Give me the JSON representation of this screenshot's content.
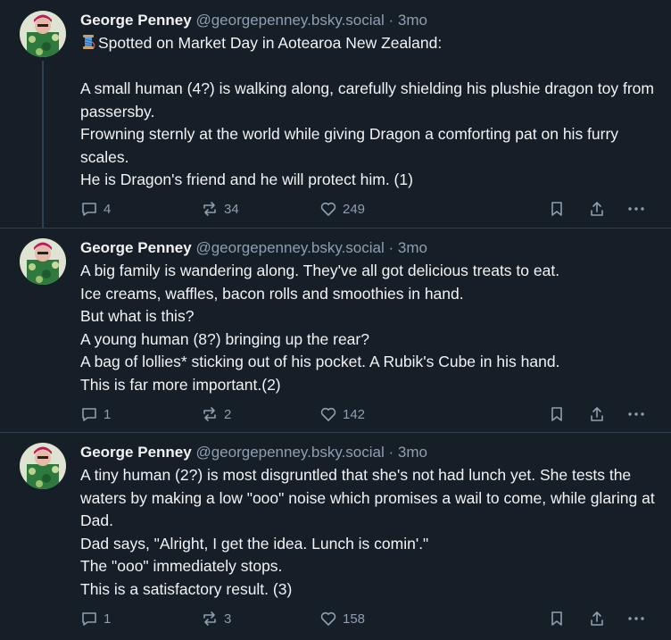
{
  "posts": [
    {
      "author": {
        "display_name": "George Penney",
        "handle": "@georgepenney.bsky.social",
        "separator": "·",
        "time": "3mo"
      },
      "paragraphs": [
        "Spotted on Market Day in Aotearoa New Zealand:",
        "",
        "A small human (4?) is walking along, carefully shielding his plushie dragon toy from passersby.",
        "Frowning sternly at the world while giving Dragon a comforting pat on his furry scales.",
        "He is Dragon's friend and he will protect him. (1)"
      ],
      "leading_emoji": "thread-spool-icon",
      "counts": {
        "replies": "4",
        "reposts": "34",
        "likes": "249"
      }
    },
    {
      "author": {
        "display_name": "George Penney",
        "handle": "@georgepenney.bsky.social",
        "separator": "·",
        "time": "3mo"
      },
      "paragraphs": [
        "A big family is wandering along. They've all got delicious treats to eat.",
        "Ice creams, waffles, bacon rolls and smoothies in hand.",
        "But what is this?",
        "A young human (8?) bringing up the rear?",
        "A bag of lollies* sticking out of his pocket. A Rubik's Cube in his hand.",
        "This is far more important.(2)"
      ],
      "counts": {
        "replies": "1",
        "reposts": "2",
        "likes": "142"
      }
    },
    {
      "author": {
        "display_name": "George Penney",
        "handle": "@georgepenney.bsky.social",
        "separator": "·",
        "time": "3mo"
      },
      "paragraphs": [
        "A tiny human (2?) is most disgruntled that she's not had lunch yet. She tests the waters by making a low \"ooo\" noise which promises a wail to come, while glaring at Dad.",
        "Dad says, \"Alright, I get the idea. Lunch is comin'.\"",
        "The \"ooo\" immediately stops.",
        "This is a satisfactory result. (3)"
      ],
      "counts": {
        "replies": "1",
        "reposts": "3",
        "likes": "158"
      }
    }
  ],
  "icons": {
    "reply": "reply-icon",
    "repost": "repost-icon",
    "like": "heart-icon",
    "save": "bookmark-icon",
    "share": "share-icon",
    "more": "more-options-icon"
  },
  "colors": {
    "background": "#161e27",
    "text": "#f1f3f5",
    "muted": "#8d9fb1",
    "divider": "#2e4052"
  }
}
